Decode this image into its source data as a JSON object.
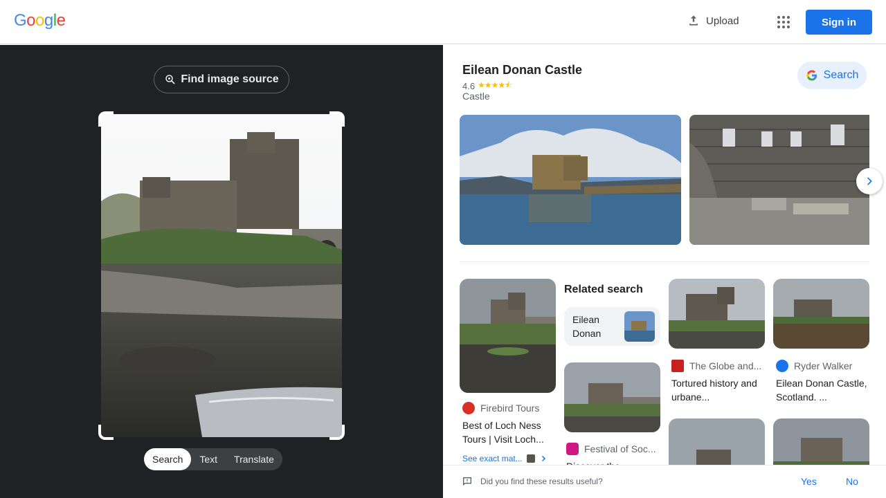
{
  "header": {
    "logo": "Google",
    "upload_label": "Upload",
    "sign_in_label": "Sign in"
  },
  "left_pane": {
    "find_source_label": "Find image source",
    "modes": [
      "Search",
      "Text",
      "Translate"
    ],
    "active_mode": "Search"
  },
  "knowledge_panel": {
    "title": "Eilean Donan Castle",
    "rating": "4.6",
    "rating_stars": 4.6,
    "type": "Castle",
    "search_label": "Search"
  },
  "results": {
    "related_title": "Related search",
    "related_chip_label": "Eilean Donan",
    "cards": [
      {
        "source": "Firebird Tours",
        "caption": "Best of Loch Ness Tours | Visit Loch...",
        "source_color": "#d93025"
      },
      {
        "source": "The Globe and...",
        "caption": "Tortured history and urbane...",
        "source_color": "#c5221f"
      },
      {
        "source": "Ryder Walker",
        "caption": "Eilean Donan Castle, Scotland. ...",
        "source_color": "#1a73e8"
      },
      {
        "source": "Festival of Soc...",
        "caption": "Discover the...",
        "source_color": "#d01884"
      }
    ],
    "see_exact_label": "See exact mat..."
  },
  "feedback": {
    "question": "Did you find these results useful?",
    "yes": "Yes",
    "no": "No"
  },
  "colors": {
    "accent": "#1a73e8",
    "dark_bg": "#202124"
  }
}
